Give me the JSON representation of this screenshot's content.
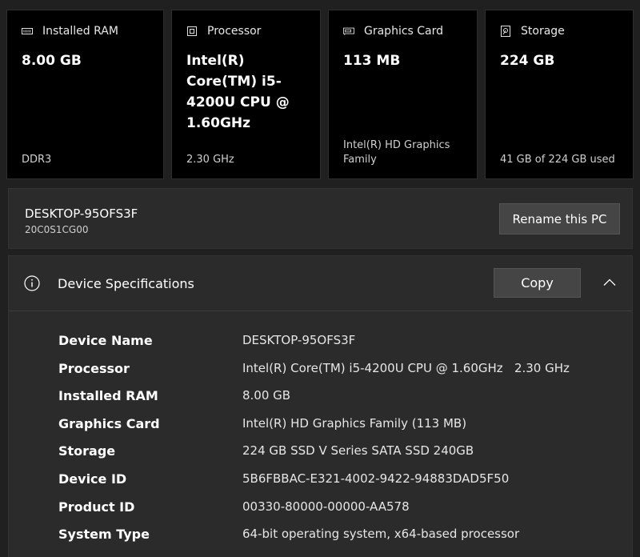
{
  "cards": [
    {
      "icon": "ram-icon",
      "label": "Installed RAM",
      "value": "8.00 GB",
      "foot": "DDR3"
    },
    {
      "icon": "processor-icon",
      "label": "Processor",
      "value": "Intel(R) Core(TM) i5-4200U CPU @ 1.60GHz",
      "foot": "2.30 GHz"
    },
    {
      "icon": "graphics-card-icon",
      "label": "Graphics Card",
      "value": "113 MB",
      "foot": "Intel(R) HD Graphics Family"
    },
    {
      "icon": "storage-icon",
      "label": "Storage",
      "value": "224 GB",
      "foot": "41 GB of 224 GB used"
    }
  ],
  "pc": {
    "name": "DESKTOP-95OFS3F",
    "model": "20C0S1CG00",
    "rename_label": "Rename this PC"
  },
  "specs": {
    "title": "Device Specifications",
    "copy_label": "Copy",
    "info_icon": "info-icon",
    "collapse_icon": "chevron-up-icon",
    "rows": [
      {
        "label": "Device Name",
        "value": "DESKTOP-95OFS3F"
      },
      {
        "label": "Processor",
        "value": "Intel(R) Core(TM) i5-4200U CPU @ 1.60GHz   2.30 GHz"
      },
      {
        "label": "Installed RAM",
        "value": "8.00 GB"
      },
      {
        "label": "Graphics Card",
        "value": "Intel(R) HD Graphics Family (113 MB)"
      },
      {
        "label": "Storage",
        "value": "224 GB SSD V Series SATA SSD 240GB"
      },
      {
        "label": "Device ID",
        "value": "5B6FBBAC-E321-4002-9422-94883DAD5F50"
      },
      {
        "label": "Product ID",
        "value": "00330-80000-00000-AA578"
      },
      {
        "label": "System Type",
        "value": "64-bit operating system, x64-based processor"
      }
    ]
  },
  "colors": {
    "background": "#202020",
    "card": "#000000",
    "panel": "#2b2b2b",
    "button": "#454545"
  }
}
